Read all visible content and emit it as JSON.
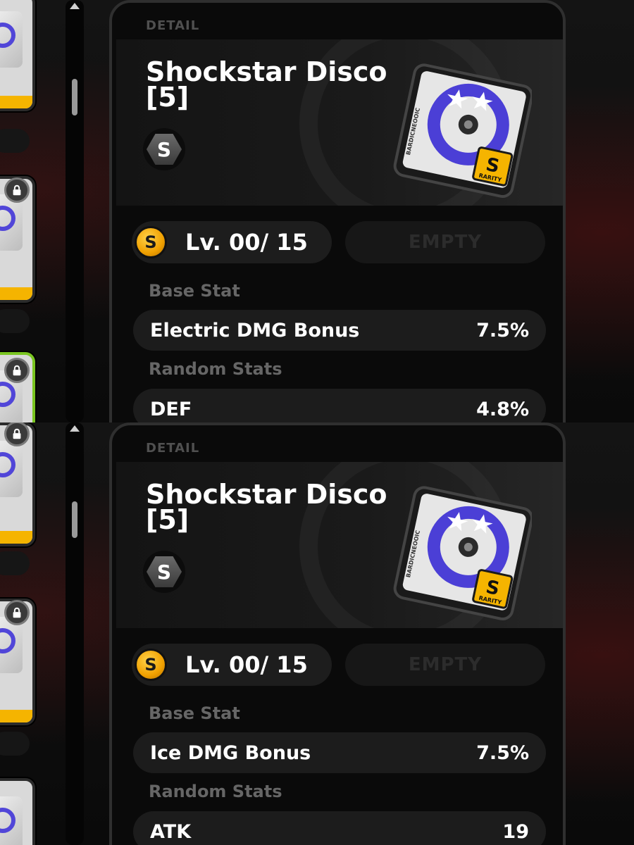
{
  "colors": {
    "gold": "#f5b400",
    "green_border": "#7ac521",
    "panel_bg": "#0a0a0a",
    "disc_purple": "#5146d8"
  },
  "icons": [
    "lock-icon",
    "rank-s-icon",
    "level-coin-icon",
    "scroll-up-icon"
  ],
  "panels": [
    {
      "label": "DETAIL",
      "title_line1": "Shockstar Disco",
      "title_line2": "[5]",
      "rank": "S",
      "disc_brand": "BARDICNEOOIC",
      "disc_rarity_badge": "S",
      "disc_rarity_text": "RARITY",
      "level_coin": "S",
      "level": "Lv. 00/ 15",
      "empty_slot": "EMPTY",
      "base_stat_label": "Base Stat",
      "base_stat": {
        "name": "Electric DMG Bonus",
        "value": "7.5%"
      },
      "random_stats_label": "Random Stats",
      "random_stats": [
        {
          "name": "DEF",
          "value": "4.8%"
        }
      ]
    },
    {
      "label": "DETAIL",
      "title_line1": "Shockstar Disco",
      "title_line2": "[5]",
      "rank": "S",
      "disc_brand": "BARDICNEOOIC",
      "disc_rarity_badge": "S",
      "disc_rarity_text": "RARITY",
      "level_coin": "S",
      "level": "Lv. 00/ 15",
      "empty_slot": "EMPTY",
      "base_stat_label": "Base Stat",
      "base_stat": {
        "name": "Ice DMG Bonus",
        "value": "7.5%"
      },
      "random_stats_label": "Random Stats",
      "random_stats": [
        {
          "name": "ATK",
          "value": "19"
        }
      ]
    }
  ]
}
